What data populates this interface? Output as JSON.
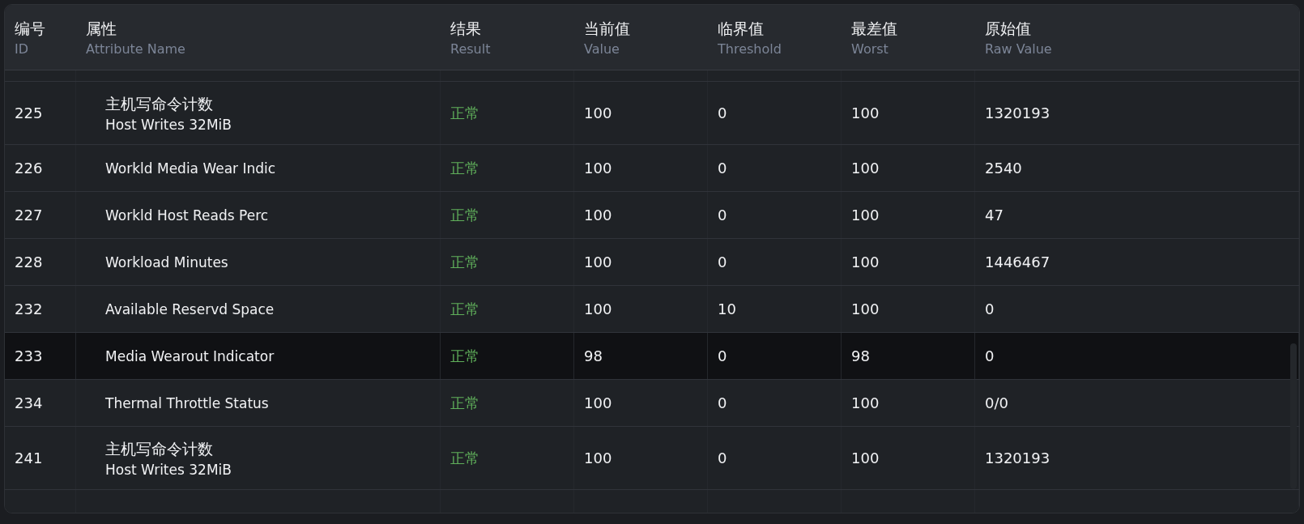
{
  "columns": [
    {
      "title": "编号",
      "subtitle": "ID"
    },
    {
      "title": "属性",
      "subtitle": "Attribute Name"
    },
    {
      "title": "结果",
      "subtitle": "Result"
    },
    {
      "title": "当前值",
      "subtitle": "Value"
    },
    {
      "title": "临界值",
      "subtitle": "Threshold"
    },
    {
      "title": "最差值",
      "subtitle": "Worst"
    },
    {
      "title": "原始值",
      "subtitle": "Raw Value"
    }
  ],
  "rows": [
    {
      "id": "225",
      "name_cn": "主机写命令计数",
      "name": "Host Writes 32MiB",
      "result": "正常",
      "value": "100",
      "threshold": "0",
      "worst": "100",
      "raw": "1320193",
      "selected": false
    },
    {
      "id": "226",
      "name": "Workld Media Wear Indic",
      "result": "正常",
      "value": "100",
      "threshold": "0",
      "worst": "100",
      "raw": "2540",
      "selected": false
    },
    {
      "id": "227",
      "name": "Workld Host Reads Perc",
      "result": "正常",
      "value": "100",
      "threshold": "0",
      "worst": "100",
      "raw": "47",
      "selected": false
    },
    {
      "id": "228",
      "name": "Workload Minutes",
      "result": "正常",
      "value": "100",
      "threshold": "0",
      "worst": "100",
      "raw": "1446467",
      "selected": false
    },
    {
      "id": "232",
      "name": "Available Reservd Space",
      "result": "正常",
      "value": "100",
      "threshold": "10",
      "worst": "100",
      "raw": "0",
      "selected": false
    },
    {
      "id": "233",
      "name": "Media Wearout Indicator",
      "result": "正常",
      "value": "98",
      "threshold": "0",
      "worst": "98",
      "raw": "0",
      "selected": true
    },
    {
      "id": "234",
      "name": "Thermal Throttle Status",
      "result": "正常",
      "value": "100",
      "threshold": "0",
      "worst": "100",
      "raw": "0/0",
      "selected": false
    },
    {
      "id": "241",
      "name_cn": "主机写命令计数",
      "name": "Host Writes 32MiB",
      "result": "正常",
      "value": "100",
      "threshold": "0",
      "worst": "100",
      "raw": "1320193",
      "selected": false
    }
  ]
}
